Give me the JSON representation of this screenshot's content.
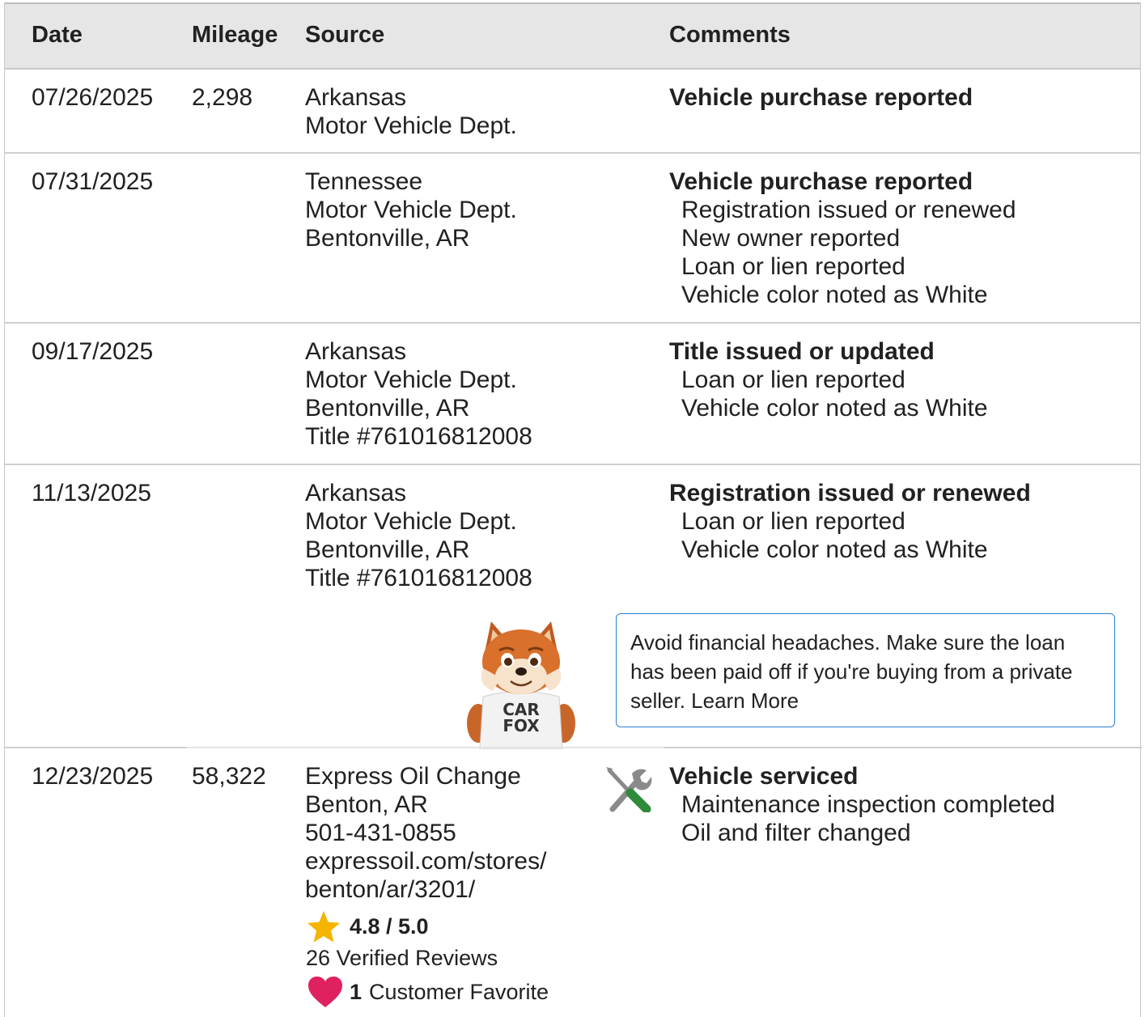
{
  "table": {
    "headers": {
      "date": "Date",
      "mileage": "Mileage",
      "source": "Source",
      "comments": "Comments"
    },
    "rows": [
      {
        "date": "07/26/2025",
        "mileage": "2,298",
        "source": [
          "Arkansas",
          "Motor Vehicle Dept."
        ],
        "comment_title": "Vehicle purchase reported",
        "comment_details": []
      },
      {
        "date": "07/31/2025",
        "mileage": "",
        "source": [
          "Tennessee",
          "Motor Vehicle Dept.",
          "Bentonville, AR"
        ],
        "comment_title": "Vehicle purchase reported",
        "comment_details": [
          "Registration issued or renewed",
          "New owner reported",
          "Loan or lien reported",
          "Vehicle color noted as White"
        ]
      },
      {
        "date": "09/17/2025",
        "mileage": "",
        "source": [
          "Arkansas",
          "Motor Vehicle Dept.",
          "Bentonville, AR",
          "Title #761016812008"
        ],
        "comment_title": "Title issued or updated",
        "comment_details": [
          "Loan or lien reported",
          "Vehicle color noted as White"
        ]
      },
      {
        "date": "11/13/2025",
        "mileage": "",
        "source": [
          "Arkansas",
          "Motor Vehicle Dept.",
          "Bentonville, AR",
          "Title #761016812008"
        ],
        "comment_title": "Registration issued or renewed",
        "comment_details": [
          "Loan or lien reported",
          "Vehicle color noted as White"
        ]
      },
      {
        "date": "12/23/2025",
        "mileage": "58,322",
        "source": [
          "Express Oil Change",
          "Benton, AR",
          "501-431-0855",
          "expressoil.com/stores/",
          "benton/ar/3201/"
        ],
        "comment_title": "Vehicle serviced",
        "comment_details": [
          "Maintenance inspection completed",
          "Oil and filter changed"
        ]
      }
    ]
  },
  "callout": {
    "text": "Avoid financial headaches. Make sure the loan has been paid off if you're buying from a private seller.",
    "link": "Learn More"
  },
  "mascot": {
    "shirt_line1": "CAR",
    "shirt_line2": "FOX"
  },
  "shop_rating": {
    "rating": "4.8 / 5.0",
    "reviews": "26 Verified Reviews",
    "favorite_count": "1",
    "favorite_label": "Customer Favorite"
  },
  "icons": {
    "service": "wrench-screwdriver-icon",
    "rating": "star-icon",
    "favorite": "heart-icon"
  },
  "colors": {
    "header_bg": "#e6e6e6",
    "callout_border": "#2f7dd1",
    "star": "#f5b400",
    "heart": "#e0215f",
    "screwdriver_handle": "#2e8b3a"
  }
}
